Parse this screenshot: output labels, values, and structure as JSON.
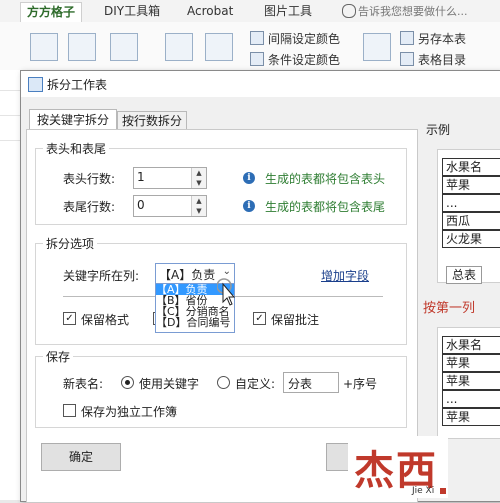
{
  "ribbon": {
    "tabs": [
      "方方格子",
      "DIY工具箱",
      "Acrobat",
      "图片工具"
    ],
    "tell_me": "告诉我您想要做什么...",
    "buttons": [
      "间隔设定颜色",
      "条件设定颜色",
      "另存本表",
      "表格目录"
    ]
  },
  "dialog": {
    "title": "拆分工作表",
    "tabs": [
      "按关键字拆分",
      "按行数拆分"
    ],
    "header_group": {
      "title": "表头和表尾",
      "header_rows_label": "表头行数:",
      "header_rows_value": "1",
      "footer_rows_label": "表尾行数:",
      "footer_rows_value": "0",
      "header_note": "生成的表都将包含表头",
      "footer_note": "生成的表都将包含表尾"
    },
    "split_group": {
      "title": "拆分选项",
      "keyword_col_label": "关键字所在列:",
      "keyword_col_value": "【A】负责",
      "add_field_link": "增加字段",
      "dropdown_items": [
        "【A】负责",
        "【B】省份",
        "【C】分销商名",
        "【D】合同编号"
      ],
      "keep_format_label": "保留格式",
      "keep_comment_label": "保留批注",
      "keep_format_checked": true,
      "keep_comment_checked": true
    },
    "save_group": {
      "title": "保存",
      "new_name_label": "新表名:",
      "use_keyword_label": "使用关键字",
      "custom_label": "自定义:",
      "custom_value": "分表",
      "suffix_label": "+序号",
      "standalone_label": "保存为独立工作簿"
    },
    "ok_button": "确定"
  },
  "preview": {
    "title": "示例",
    "top_rows": [
      "水果名",
      "苹果",
      "...",
      "西瓜",
      "火龙果"
    ],
    "sheet_tab": "总表",
    "caption": "按第一列",
    "bottom_rows": [
      "水果名",
      "苹果",
      "苹果",
      "...",
      "苹果"
    ]
  },
  "watermark": {
    "main": "杰西",
    "sub": "Jie Xi"
  }
}
